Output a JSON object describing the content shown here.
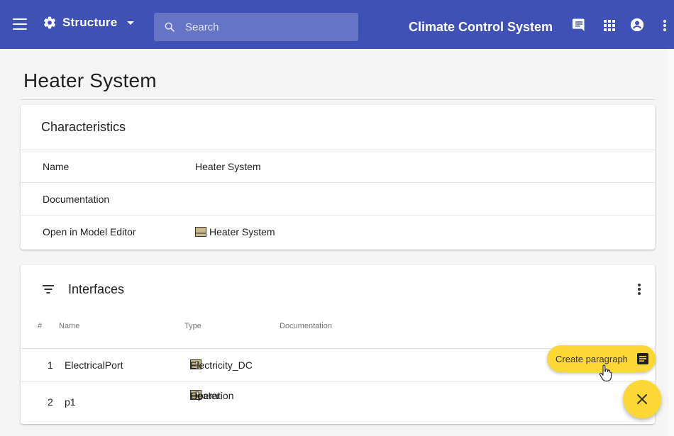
{
  "header": {
    "menu_icon": "menu-icon",
    "section_label": "Structure",
    "section_icon": "gear-icon",
    "search_placeholder": "Search",
    "app_title": "Climate Control System",
    "icons": [
      "comment-icon",
      "apps-grid-icon",
      "account-circle-icon",
      "more-vertical-icon"
    ],
    "color": "#3f51b5"
  },
  "page": {
    "title": "Heater System"
  },
  "characteristics": {
    "heading": "Characteristics",
    "rows": [
      {
        "key": "Name",
        "value": "Heater System"
      },
      {
        "key": "Documentation",
        "value": ""
      },
      {
        "key": "Open in Model Editor",
        "value": "Heater System",
        "icon": "model-element-icon"
      }
    ]
  },
  "interfaces": {
    "heading": "Interfaces",
    "columns": [
      "#",
      "Name",
      "Type",
      "Documentation"
    ],
    "rows": [
      {
        "index": "1",
        "name": "ElectricalPort",
        "type": "Electricity_DC",
        "type_icon": "interface-block-icon",
        "doc": ""
      },
      {
        "index": "2",
        "name": "p1",
        "type_line1": "Heater",
        "type_line2": "Operation",
        "type_icon": "interface-block-icon",
        "doc": ""
      }
    ]
  },
  "fab": {
    "chip_label": "Create paragraph",
    "chip_icon": "paragraph-icon",
    "close_icon": "close-icon",
    "color": "#fdd835"
  }
}
